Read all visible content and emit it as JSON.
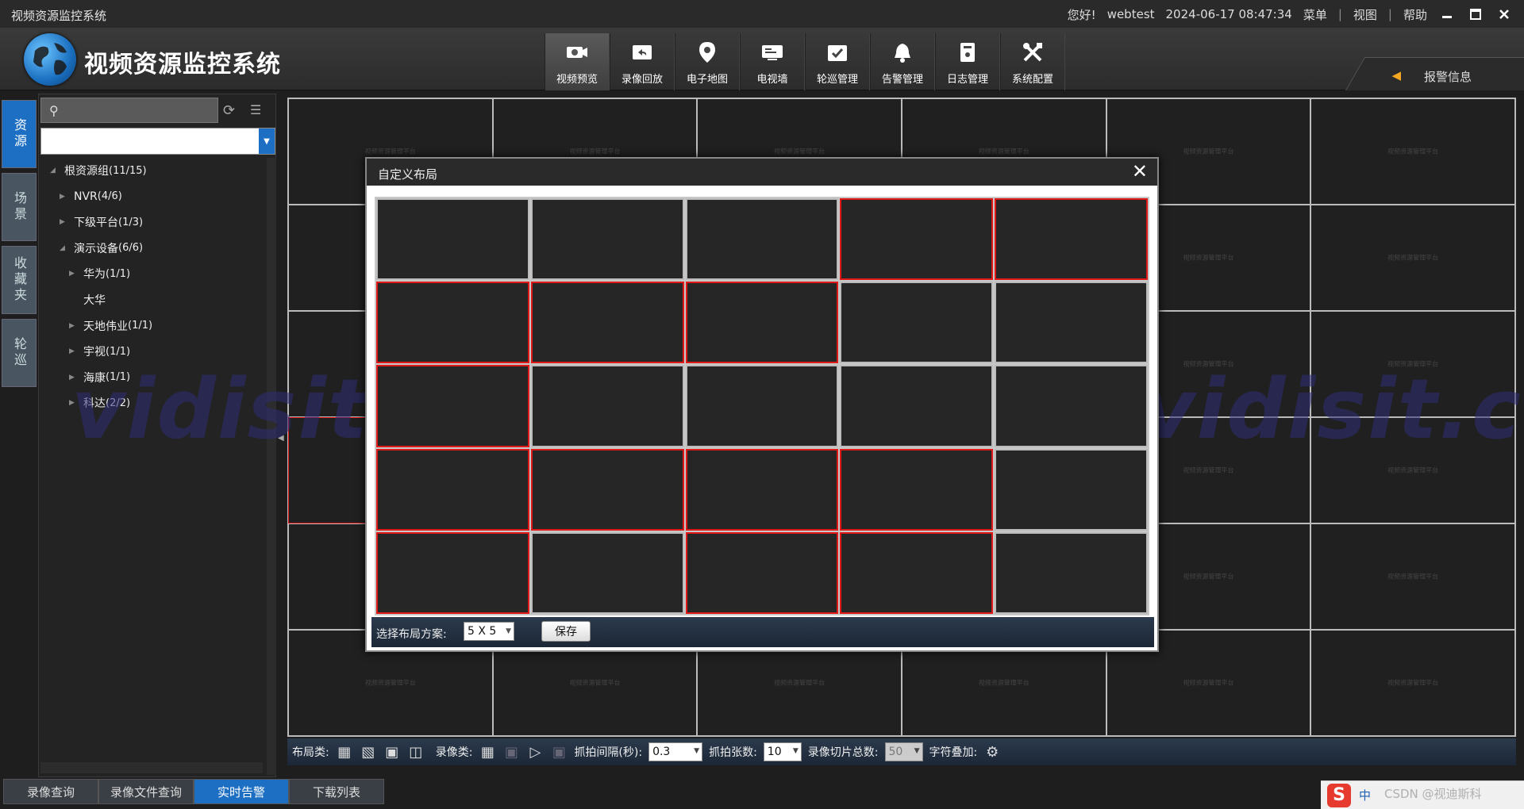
{
  "titlebar": {
    "app_title": "视频资源监控系统",
    "greeting": "您好!",
    "username": "webtest",
    "datetime": "2024-06-17 08:47:34",
    "menu": "菜单",
    "view": "视图",
    "help": "帮助",
    "sep": "|"
  },
  "header": {
    "system_title": "视频资源监控系统",
    "alarm_info": "报警信息",
    "nav": [
      {
        "label": "视频预览",
        "icon": "camera-icon"
      },
      {
        "label": "录像回放",
        "icon": "playback-icon"
      },
      {
        "label": "电子地图",
        "icon": "map-pin-icon"
      },
      {
        "label": "电视墙",
        "icon": "tv-wall-icon"
      },
      {
        "label": "轮巡管理",
        "icon": "patrol-icon"
      },
      {
        "label": "告警管理",
        "icon": "bell-icon"
      },
      {
        "label": "日志管理",
        "icon": "log-icon"
      },
      {
        "label": "系统配置",
        "icon": "tools-icon"
      }
    ]
  },
  "left_tabs": [
    "资源",
    "场景",
    "收藏夹",
    "轮巡"
  ],
  "tree": [
    {
      "label": "根资源组",
      "count": "(11/15)",
      "level": 0,
      "toggle": "expanded"
    },
    {
      "label": "NVR",
      "count": "(4/6)",
      "level": 1,
      "toggle": "collapsed"
    },
    {
      "label": "下级平台",
      "count": "(1/3)",
      "level": 1,
      "toggle": "collapsed"
    },
    {
      "label": "演示设备",
      "count": "(6/6)",
      "level": 1,
      "toggle": "expanded"
    },
    {
      "label": "华为",
      "count": "(1/1)",
      "level": 2,
      "toggle": "collapsed"
    },
    {
      "label": "大华",
      "count": "",
      "level": 2,
      "toggle": "none"
    },
    {
      "label": "天地伟业",
      "count": "(1/1)",
      "level": 2,
      "toggle": "collapsed"
    },
    {
      "label": "宇视",
      "count": "(1/1)",
      "level": 2,
      "toggle": "collapsed"
    },
    {
      "label": "海康",
      "count": "(1/1)",
      "level": 2,
      "toggle": "collapsed"
    },
    {
      "label": "科达",
      "count": "(2/2)",
      "level": 2,
      "toggle": "collapsed"
    }
  ],
  "grid": {
    "cell_watermark": "视频资源管理平台"
  },
  "watermark_text": "vidisit.cn , vidisit.cn , vidisit.cn",
  "toolbar": {
    "layout_label": "布局类:",
    "record_label": "录像类:",
    "interval_label": "抓拍间隔(秒):",
    "interval_value": "0.3",
    "count_label": "抓拍张数:",
    "count_value": "10",
    "slice_label": "录像切片总数:",
    "slice_value": "50",
    "overlay_label": "字符叠加:"
  },
  "bottom_tabs": [
    "录像查询",
    "录像文件查询",
    "实时告警",
    "下载列表"
  ],
  "dialog": {
    "title": "自定义布局",
    "close": "✕",
    "select_label": "选择布局方案:",
    "layout_value": "5 X 5",
    "save": "保存",
    "selected_cells": [
      0,
      0,
      0,
      1,
      1,
      1,
      1,
      1,
      0,
      0,
      1,
      0,
      0,
      0,
      0,
      1,
      1,
      1,
      1,
      0,
      1,
      0,
      1,
      1,
      0
    ]
  },
  "ime": {
    "lang": "中",
    "csdn": "CSDN @视迪斯科"
  },
  "colors": {
    "accent": "#1d6fc4",
    "selected": "#e01818"
  }
}
